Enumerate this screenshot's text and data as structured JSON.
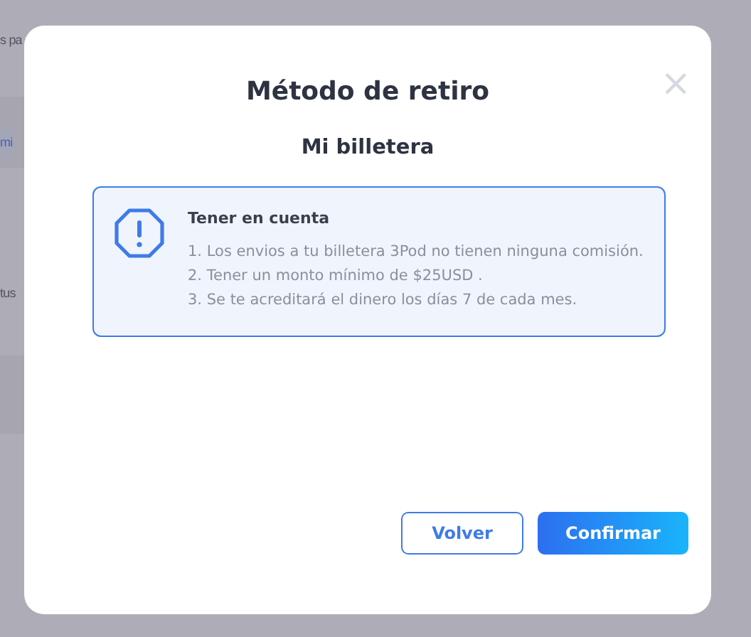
{
  "background": {
    "texts": [
      {
        "text": "s pa",
        "kind": "plain"
      },
      {
        "text": "mi",
        "kind": "link"
      },
      {
        "text": "tus",
        "kind": "plain"
      }
    ]
  },
  "modal": {
    "title": "Método de retiro",
    "subtitle": "Mi billetera",
    "close": "×",
    "notice": {
      "heading": "Tener en cuenta",
      "items": [
        "1. Los envios a tu billetera 3Pod no tienen ninguna comisión.",
        "2. Tener un monto mínimo de $25USD .",
        "3. Se te acreditará el dinero los días 7 de cada mes."
      ]
    },
    "buttons": [
      {
        "label": "Volver",
        "kind": "outline"
      },
      {
        "label": "Confirmar",
        "kind": "primary"
      }
    ]
  }
}
